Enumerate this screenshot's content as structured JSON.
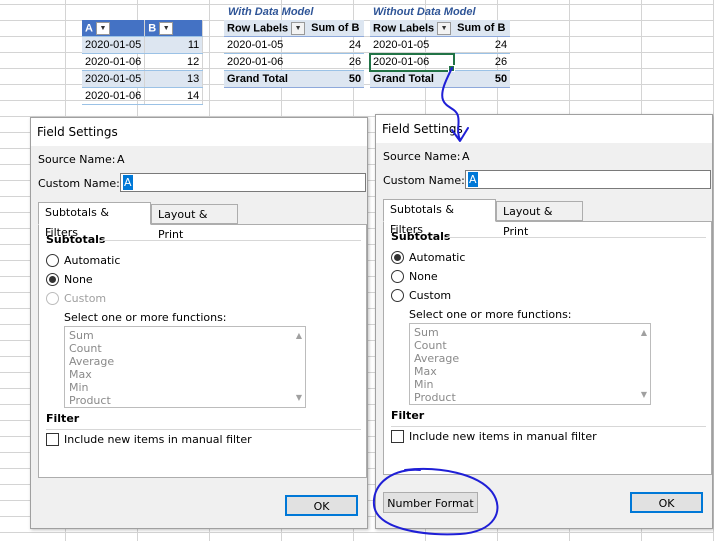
{
  "sheet": {
    "source_table": {
      "headers": [
        "A",
        "B"
      ],
      "rows": [
        [
          "2020-01-05",
          "11"
        ],
        [
          "2020-01-06",
          "12"
        ],
        [
          "2020-01-05",
          "13"
        ],
        [
          "2020-01-06",
          "14"
        ]
      ]
    },
    "pivot_with_model": {
      "title": "With Data Model",
      "headers": [
        "Row Labels",
        "Sum of B"
      ],
      "rows": [
        [
          "2020-01-05",
          "24"
        ],
        [
          "2020-01-06",
          "26"
        ]
      ],
      "total": [
        "Grand Total",
        "50"
      ]
    },
    "pivot_without_model": {
      "title": "Without Data Model",
      "headers": [
        "Row Labels",
        "Sum of B"
      ],
      "rows": [
        [
          "2020-01-05",
          "24"
        ],
        [
          "2020-01-06",
          "26"
        ]
      ],
      "total": [
        "Grand Total",
        "50"
      ]
    }
  },
  "dialog_left": {
    "title": "Field Settings",
    "source_name_label": "Source Name:",
    "source_name_value": "A",
    "custom_name_label": "Custom Name:",
    "custom_name_value": "A",
    "tabs": [
      "Subtotals & Filters",
      "Layout & Print"
    ],
    "subtotals_header": "Subtotals",
    "options": [
      "Automatic",
      "None",
      "Custom"
    ],
    "functions_label": "Select one or more functions:",
    "functions": [
      "Sum",
      "Count",
      "Average",
      "Max",
      "Min",
      "Product"
    ],
    "filter_header": "Filter",
    "include_label": "Include new items in manual filter",
    "ok_label": "OK"
  },
  "dialog_right": {
    "title": "Field Settings",
    "source_name_label": "Source Name:",
    "source_name_value": "A",
    "custom_name_label": "Custom Name:",
    "custom_name_value": "A",
    "tabs": [
      "Subtotals & Filters",
      "Layout & Print"
    ],
    "subtotals_header": "Subtotals",
    "options": [
      "Automatic",
      "None",
      "Custom"
    ],
    "functions_label": "Select one or more functions:",
    "functions": [
      "Sum",
      "Count",
      "Average",
      "Max",
      "Min",
      "Product"
    ],
    "filter_header": "Filter",
    "include_label": "Include new items in manual filter",
    "number_format_label": "Number Format",
    "ok_label": "OK"
  },
  "colors": {
    "table_header": "#4472c4",
    "band": "#dde6f1",
    "pivot_title": "#2f5597",
    "annotation": "#1f1fd6",
    "default_button_border": "#0078d7"
  }
}
